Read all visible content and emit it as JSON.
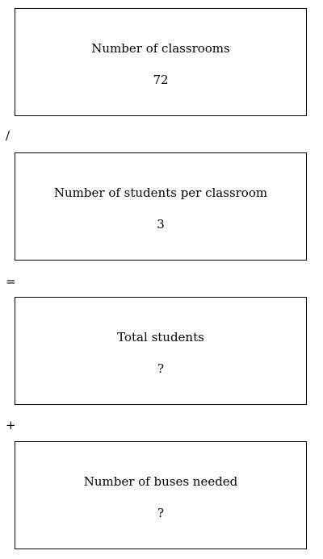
{
  "steps": [
    {
      "label": "Number of classrooms",
      "value": "72"
    },
    {
      "label": "Number of students per classroom",
      "value": "3"
    },
    {
      "label": "Total students",
      "value": "?"
    },
    {
      "label": "Number of buses needed",
      "value": "?"
    }
  ],
  "operators": [
    "/",
    "=",
    "+"
  ]
}
